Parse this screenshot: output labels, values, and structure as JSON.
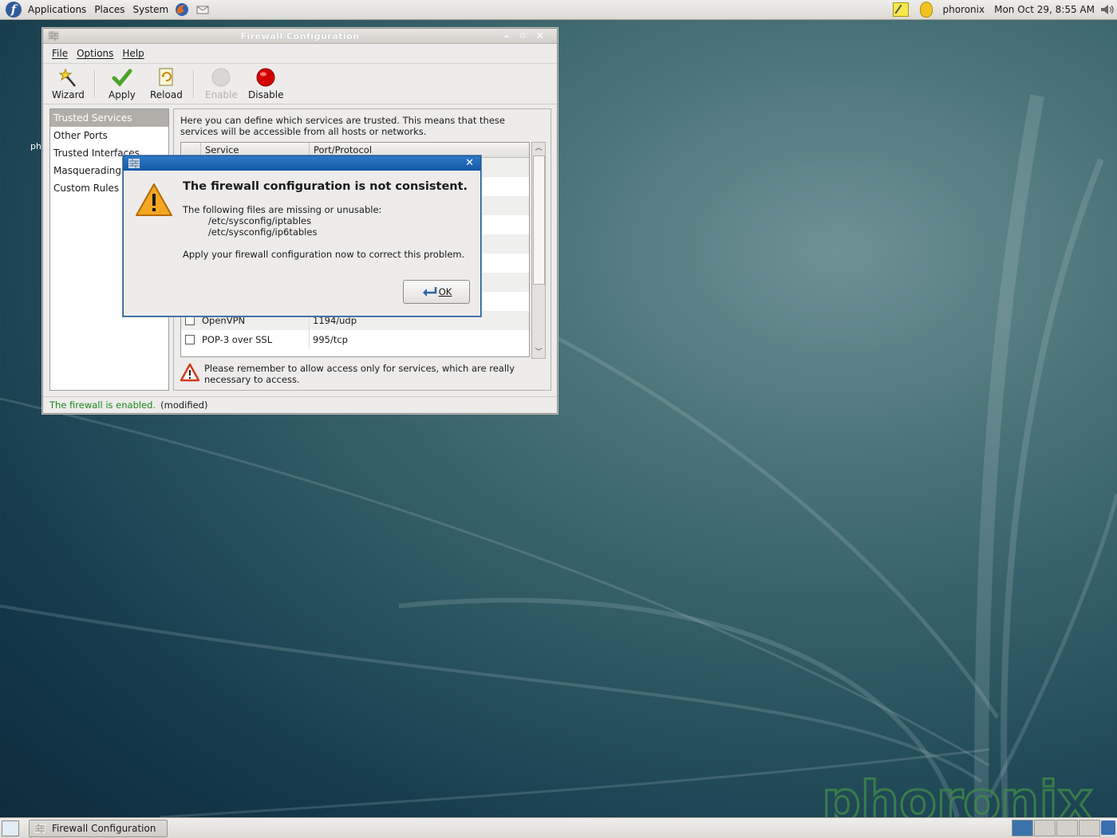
{
  "top_panel": {
    "menus": [
      "Applications",
      "Places",
      "System"
    ],
    "user": "phoronix",
    "clock": "Mon Oct 29,  8:55 AM"
  },
  "desktop": {
    "icon_label_fragment": "ph"
  },
  "window": {
    "title": "Firewall Configuration",
    "menubar": [
      "File",
      "Options",
      "Help"
    ],
    "toolbar": {
      "wizard": "Wizard",
      "apply": "Apply",
      "reload": "Reload",
      "enable": "Enable",
      "disable": "Disable"
    },
    "nav": [
      {
        "label": "Trusted Services",
        "selected": true
      },
      {
        "label": "Other Ports",
        "selected": false
      },
      {
        "label": "Trusted Interfaces",
        "selected": false
      },
      {
        "label": "Masquerading",
        "selected": false
      },
      {
        "label": "Custom Rules",
        "selected": false
      }
    ],
    "intro": "Here you can define which services are trusted. This means that these services will be accessible from all hosts or networks.",
    "table": {
      "headers": [
        "Service",
        "Port/Protocol"
      ],
      "rows": [
        {
          "service": "OpenVPN",
          "port": "1194/udp",
          "checked": false
        },
        {
          "service": "POP-3 over SSL",
          "port": "995/tcp",
          "checked": false
        }
      ]
    },
    "notice": "Please remember to allow access only for services, which are really necessary to access.",
    "status": {
      "enabled_text": "The firewall is enabled.",
      "modified_text": "(modified)"
    }
  },
  "dialog": {
    "heading": "The firewall configuration is not consistent.",
    "line1": "The following files are missing or unusable:",
    "file1": "/etc/sysconfig/iptables",
    "file2": "/etc/sysconfig/ip6tables",
    "line2": "Apply your firewall configuration now to correct this problem.",
    "ok_label": "OK"
  },
  "bottom_panel": {
    "task_label": "Firewall Configuration",
    "workspace_count": 4
  },
  "colors": {
    "dialog_title": "#1559a6",
    "status_enabled": "#1a8a1a",
    "selection": "#b0aea8",
    "disable_red": "#d40000"
  },
  "icons": [
    "fedora-logo-icon",
    "firefox-icon",
    "mail-icon",
    "note-icon",
    "updater-icon",
    "volume-icon",
    "wizard-icon",
    "apply-icon",
    "reload-icon",
    "enable-icon",
    "disable-icon",
    "warning-icon",
    "ok-icon"
  ]
}
